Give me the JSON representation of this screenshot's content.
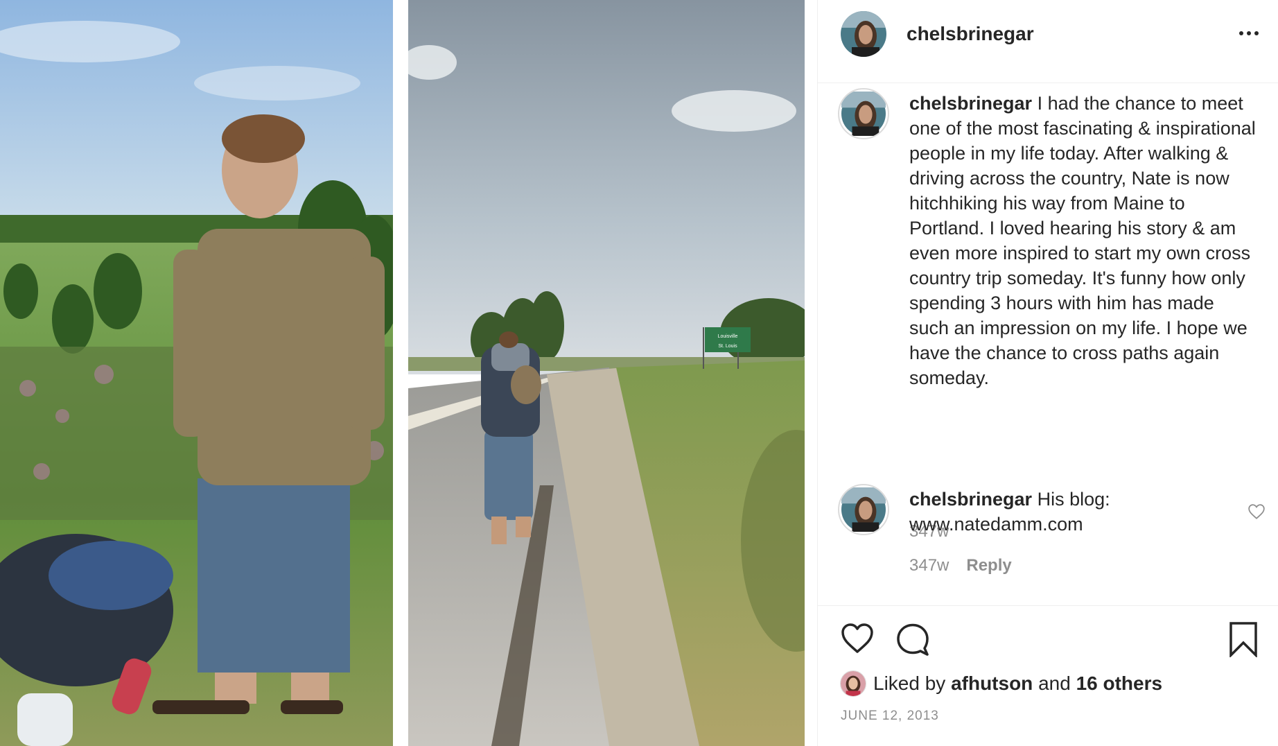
{
  "post": {
    "username": "chelsbrinegar",
    "more_icon": "more-horizontal-icon"
  },
  "caption": {
    "username": "chelsbrinegar",
    "text": " I had the chance to meet one of the most fascinating & inspirational people in my life today. After walking & driving across the country, Nate is now hitchhiking his way from Maine to Portland. I loved hearing his story & am even more inspired to start my own cross country trip someday. It's funny how only spending 3 hours with him has made such an impression on my life. I hope we have the chance to cross paths again someday.",
    "time": "347w"
  },
  "comment": {
    "username": "chelsbrinegar",
    "text": " His blog: www.natedamm.com",
    "time": "347w",
    "reply_label": "Reply"
  },
  "actions": {
    "liked_prefix": "Liked by ",
    "liked_user": "afhutson",
    "liked_and": " and ",
    "liked_others": "16 others",
    "date": "JUNE 12, 2013"
  },
  "media": {
    "photo_left": "man standing in field with backpacks",
    "photo_right": "hitchhiker walking along highway",
    "sign_line_1": "Louisville",
    "sign_line_2": "St. Louis"
  },
  "colors": {
    "text": "#262626",
    "muted": "#8e8e8e",
    "border": "#efefef"
  }
}
